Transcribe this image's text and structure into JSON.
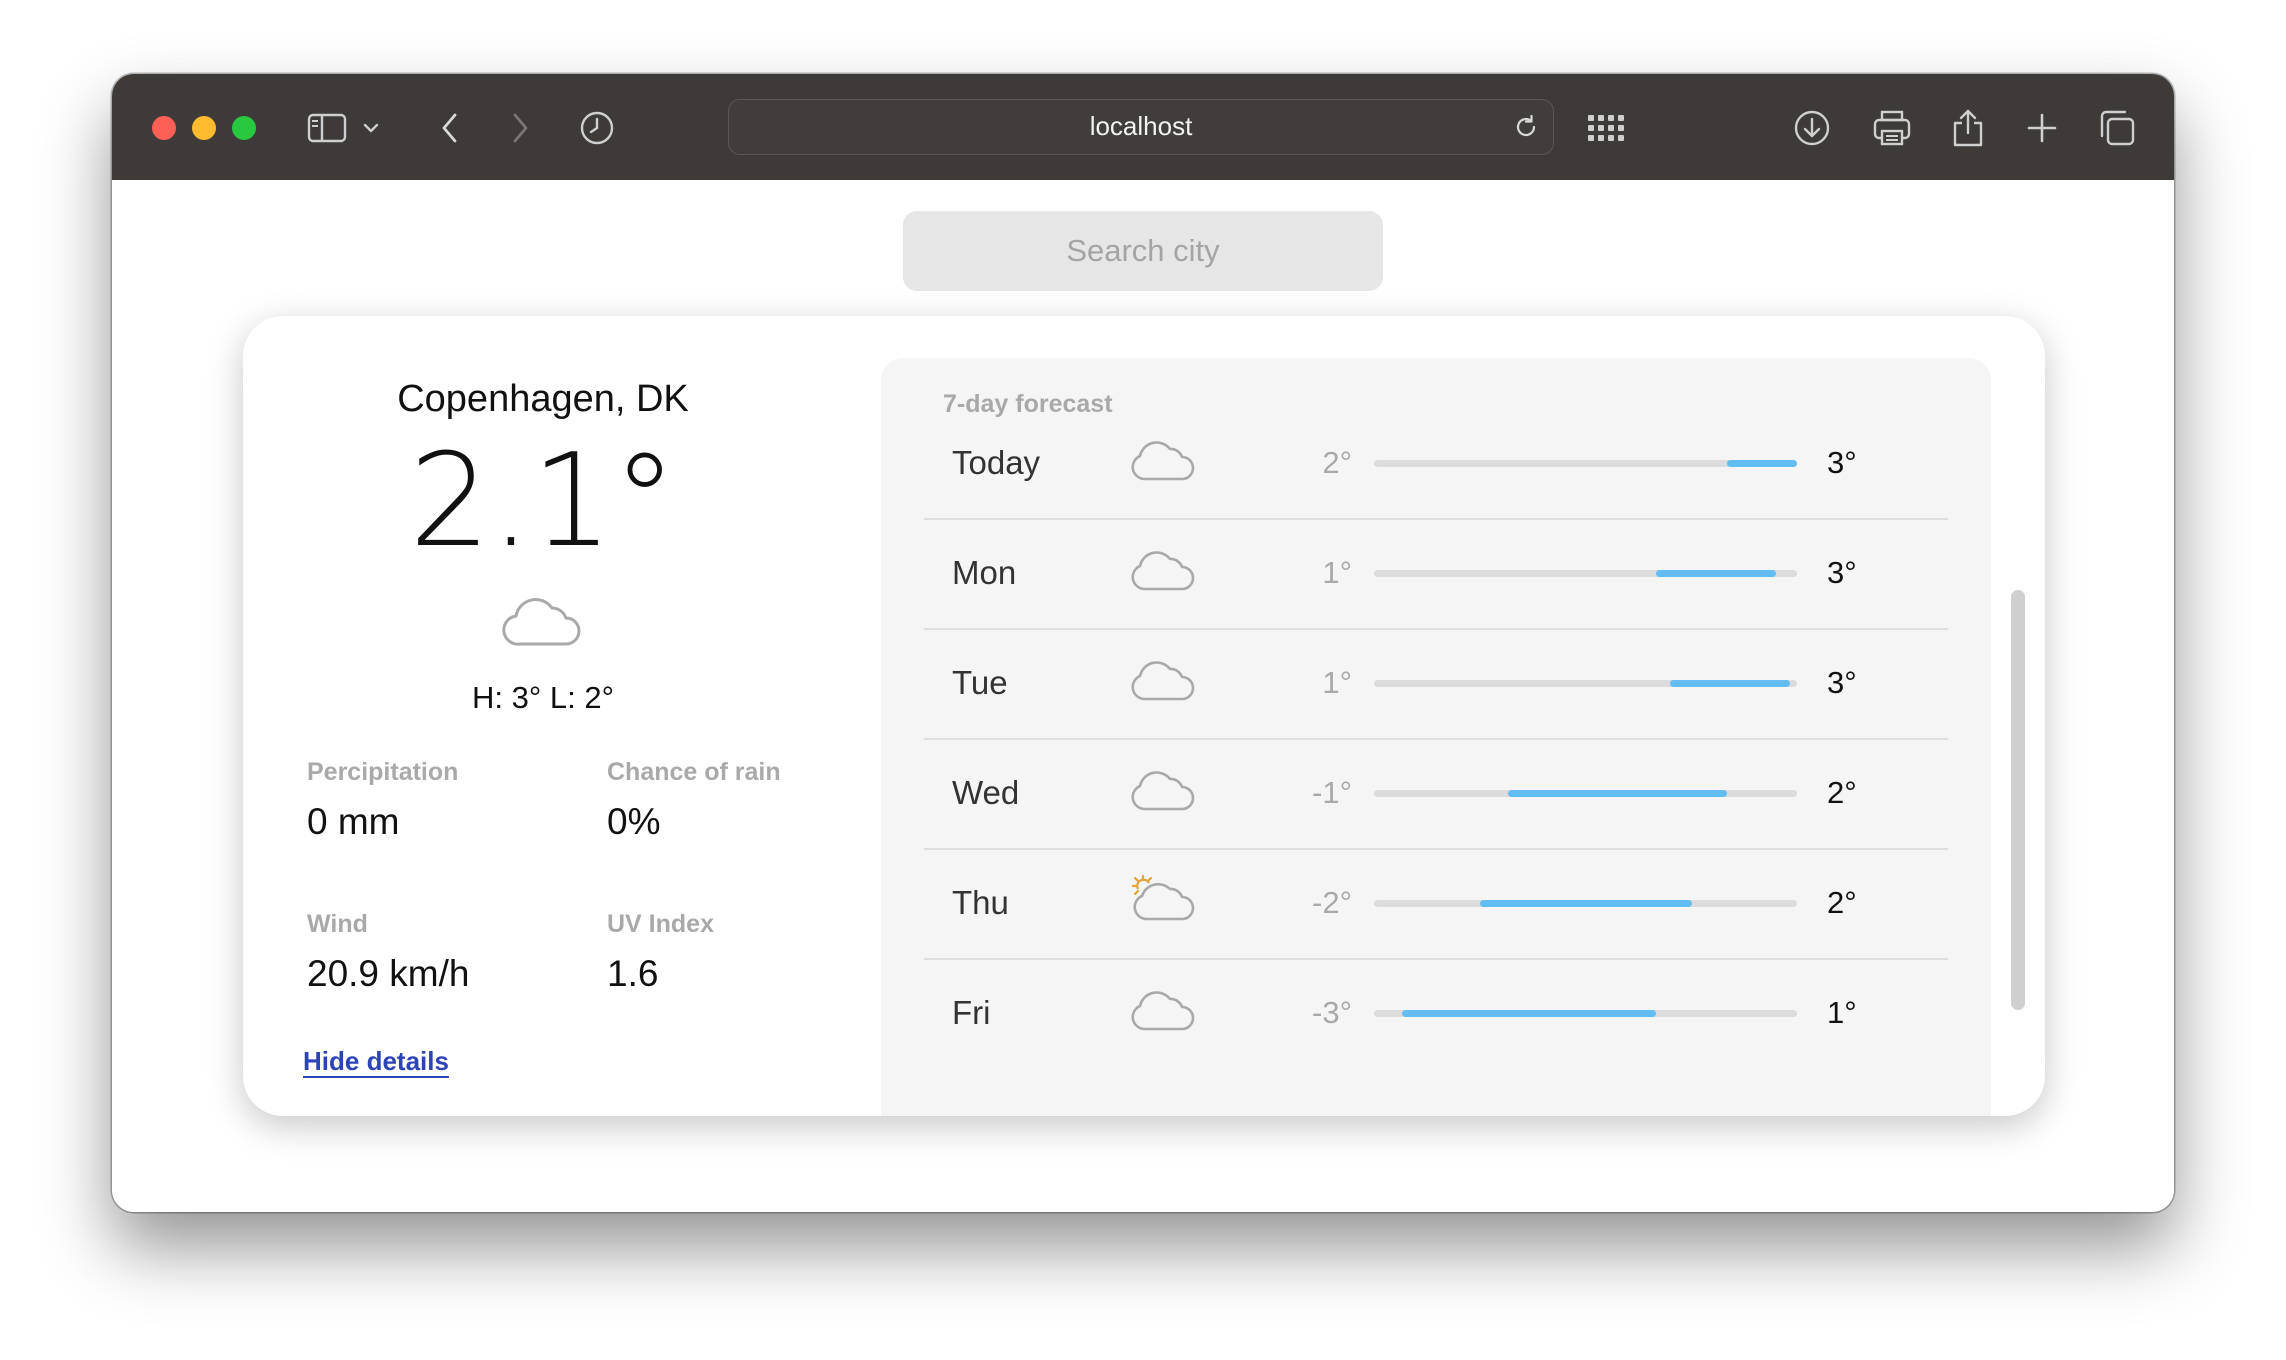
{
  "browser": {
    "url": "localhost"
  },
  "search": {
    "placeholder": "Search city"
  },
  "current": {
    "city": "Copenhagen, DK",
    "temperature": "2.1°",
    "condition_icon": "cloud-icon",
    "high_low": "H: 3° L: 2°",
    "details": [
      {
        "label": "Percipitation",
        "value": "0 mm"
      },
      {
        "label": "Chance of rain",
        "value": "0%"
      },
      {
        "label": "Wind",
        "value": "20.9 km/h"
      },
      {
        "label": "UV Index",
        "value": "1.6"
      }
    ],
    "hide_details": "Hide details"
  },
  "forecast": {
    "title": "7-day forecast",
    "scale_min": -3,
    "scale_max": 3,
    "days": [
      {
        "day": "Today",
        "icon": "cloud-icon",
        "low": "2°",
        "high": "3°",
        "range": [
          2,
          3
        ]
      },
      {
        "day": "Mon",
        "icon": "cloud-icon",
        "low": "1°",
        "high": "3°",
        "range": [
          1,
          2.7
        ]
      },
      {
        "day": "Tue",
        "icon": "cloud-icon",
        "low": "1°",
        "high": "3°",
        "range": [
          1.2,
          2.9
        ]
      },
      {
        "day": "Wed",
        "icon": "cloud-icon",
        "low": "-1°",
        "high": "2°",
        "range": [
          -1.1,
          2
        ]
      },
      {
        "day": "Thu",
        "icon": "partly-sunny-icon",
        "low": "-2°",
        "high": "2°",
        "range": [
          -1.5,
          1.5
        ]
      },
      {
        "day": "Fri",
        "icon": "cloud-icon",
        "low": "-3°",
        "high": "1°",
        "range": [
          -2.6,
          1
        ]
      }
    ]
  },
  "colors": {
    "bar_fill": "#63bdf0",
    "link": "#2d44b8",
    "toolbar": "#3d3a38"
  }
}
